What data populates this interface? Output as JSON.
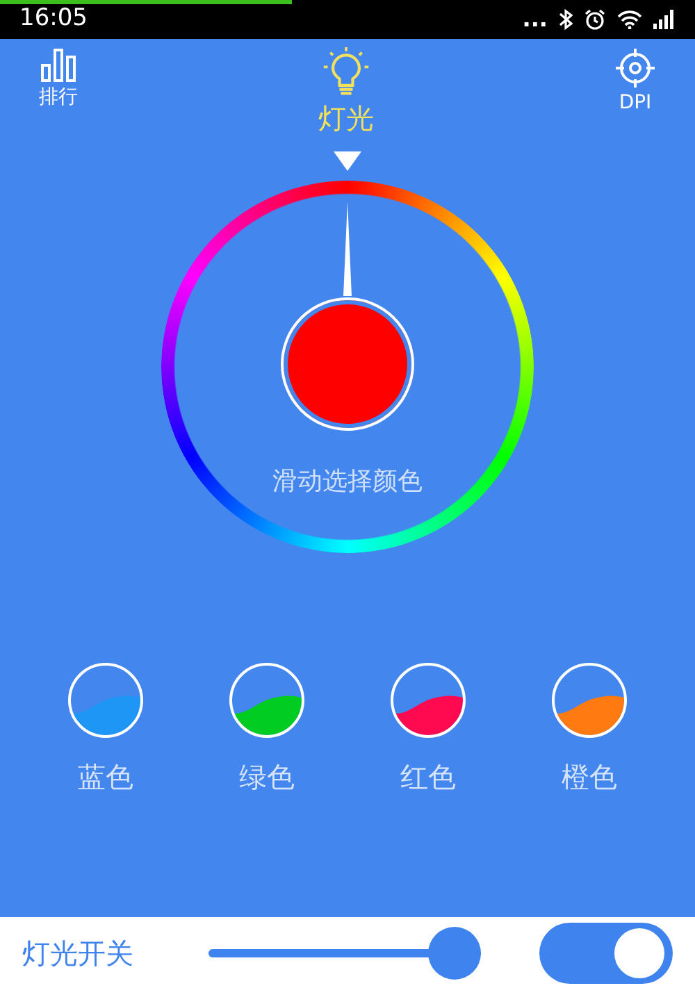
{
  "status_bar": {
    "time": "16:05",
    "more": "..."
  },
  "tabs": [
    {
      "label": "排行",
      "kind": "chart",
      "selected": false
    },
    {
      "label": "灯光",
      "kind": "bulb",
      "selected": true
    },
    {
      "label": "DPI",
      "kind": "target",
      "selected": false
    }
  ],
  "color_wheel": {
    "color": "#ff0000",
    "hint": "滑动选择颜色"
  },
  "presets": [
    {
      "label": "蓝色",
      "color": "#1e96f5"
    },
    {
      "label": "绿色",
      "color": "#00cc22"
    },
    {
      "label": "红色",
      "color": "#ff0a50"
    },
    {
      "label": "橙色",
      "color": "#ff7a10"
    }
  ],
  "light_switch": {
    "label": "灯光开关",
    "level": 1,
    "on": true
  }
}
